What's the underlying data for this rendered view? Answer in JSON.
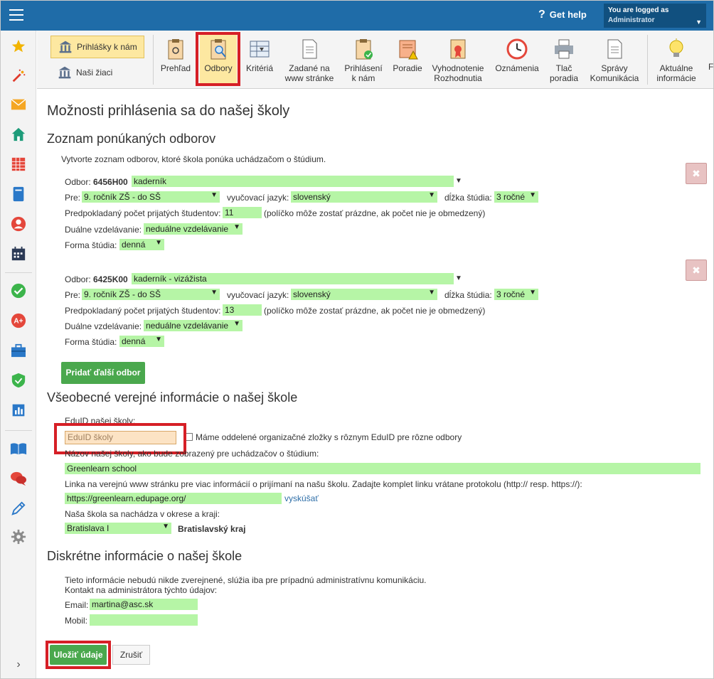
{
  "topbar": {
    "help_label": "Get help",
    "logged_line1": "You are logged as",
    "logged_line2": "Administrator"
  },
  "sidebar": {
    "icons": [
      "star-icon",
      "magic-wand-icon",
      "envelope-icon",
      "home-icon",
      "timetable-icon",
      "book-icon",
      "user-icon",
      "calendar-icon",
      "check-icon",
      "plus-badge-icon",
      "briefcase-icon",
      "shield-icon",
      "bar-chart-icon",
      "open-book-icon",
      "chat-icon",
      "pen-icon",
      "gear-icon",
      "chevron-right-icon"
    ]
  },
  "toolbar": {
    "left_buttons": [
      {
        "label": "Prihlášky k nám"
      },
      {
        "label": "Naši žiaci"
      }
    ],
    "items": [
      {
        "label": "Prehľad"
      },
      {
        "label": "Odbory"
      },
      {
        "label": "Kritériá"
      },
      {
        "label1": "Zadané na",
        "label2": "www stránke"
      },
      {
        "label1": "Prihlásení",
        "label2": "k nám"
      },
      {
        "label": "Poradie"
      },
      {
        "label1": "Vyhodnotenie",
        "label2": "Rozhodnutia"
      },
      {
        "label": "Oznámenia"
      },
      {
        "label1": "Tlač",
        "label2": "poradia"
      },
      {
        "label1": "Správy",
        "label2": "Komunikácia"
      },
      {
        "label1": "Aktuálne",
        "label2": "informácie"
      }
    ]
  },
  "page": {
    "title": "Možnosti prihlásenia sa do našej školy",
    "section1": {
      "heading": "Zoznam ponúkaných odborov",
      "intro": "Vytvorte zoznam odborov, ktoré škola ponúka uchádzačom o štúdium.",
      "field_labels": {
        "odbor": "Odbor:",
        "pre": "Pre:",
        "jazyk": "vyučovací jazyk:",
        "dlzka": "dĺžka štúdia:",
        "pocet": "Predpokladaný počet prijatých študentov:",
        "pocet_hint": "(políčko môže zostať prázdne, ak počet nie je obmedzený)",
        "dualne": "Duálne vzdelávanie:",
        "forma": "Forma štúdia:"
      },
      "odbory": [
        {
          "code": "6456H00",
          "name": "kaderník",
          "pre": "9. ročník ZŠ - do SŠ",
          "jazyk": "slovenský",
          "dlzka": "3 ročné",
          "pocet": "11",
          "dualne": "neduálne vzdelávanie",
          "forma": "denná"
        },
        {
          "code": "6425K00",
          "name": "kaderník - vizážista",
          "pre": "9. ročník ZŠ - do SŠ",
          "jazyk": "slovenský",
          "dlzka": "3 ročné",
          "pocet": "13",
          "dualne": "neduálne vzdelávanie",
          "forma": "denná"
        }
      ],
      "add_button": "Pridať ďalší odbor"
    },
    "section2": {
      "heading": "Všeobecné verejné informácie o našej škole",
      "eduid_label": "EduID našej školy:",
      "eduid_placeholder": "EduID školy",
      "eduid_checkbox_label": "Máme oddelené organizačné zložky s rôznym EduID pre rôzne odbory",
      "name_label": "Názov našej školy, ako bude zobrazený pre uchádzačov o štúdium:",
      "name_value": "Greenlearn school",
      "link_label": "Linka na verejnú www stránku pre viac informácií o prijímaní na našu školu. Zadajte komplet linku vrátane protokolu (http:// resp. https://):",
      "link_value": "https://greenlearn.edupage.org/",
      "try_link": "vyskúšať",
      "region_label": "Naša škola sa nachádza v okrese a kraji:",
      "okres": "Bratislava I",
      "kraj": "Bratislavský kraj"
    },
    "section3": {
      "heading": "Diskrétne informácie o našej škole",
      "info_line1": "Tieto informácie nebudú nikde zverejnené, slúžia iba pre prípadnú administratívnu komunikáciu.",
      "info_line2": "Kontakt na administrátora týchto údajov:",
      "email_label": "Email:",
      "email_value": "martina@asc.sk",
      "mobil_label": "Mobil:",
      "mobil_value": ""
    },
    "save_button": "Uložiť údaje",
    "cancel_button": "Zrušiť"
  }
}
